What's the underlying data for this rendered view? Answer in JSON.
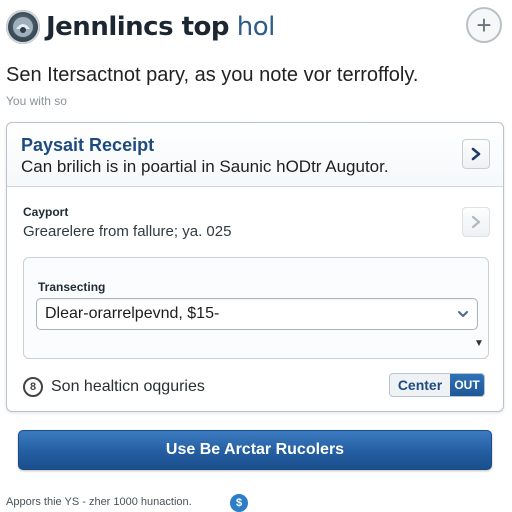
{
  "header": {
    "title_main": "Jennlincs top",
    "title_accent": "hol",
    "logo_icon": "app-logo-icon",
    "add_button_icon": "plus-icon",
    "add_button_glyph": "+"
  },
  "intro": {
    "text": "Sen Itersactnot pary, as you note vor terroffoly.",
    "subtext": "You with so"
  },
  "receipt": {
    "title": "Paysait Receipt",
    "description": "Can brilich is in poartial in Saunic hODtr Augutor.",
    "chevron_icon": "chevron-right-icon"
  },
  "payment": {
    "label": "Cayport",
    "value": "Grearelere from fallure; ya. 025",
    "chevron_icon": "chevron-right-icon"
  },
  "transaction": {
    "label": "Transecting",
    "select_value": "Dlear-orarrelpevnd, $15-",
    "select_arrow_glyph": "⌄",
    "secondary_arrow_glyph": "▼"
  },
  "info": {
    "icon": "info-circle-icon",
    "icon_glyph": "8",
    "text": "Son healticn oqguries"
  },
  "center_toggle": {
    "left_label": "Center",
    "right_label": "OUT"
  },
  "primary_button": {
    "label": "Use Be Arctar Rucolers"
  },
  "footer": {
    "text": "Appors thie YS - zher 1000 hunaction.",
    "icon": "dollar-badge-icon",
    "icon_glyph": "$"
  },
  "colors": {
    "accent": "#1e4a80",
    "primary_button": "#245ea1",
    "toggle_active": "#1f5796",
    "footer_icon": "#2c7ec7"
  }
}
